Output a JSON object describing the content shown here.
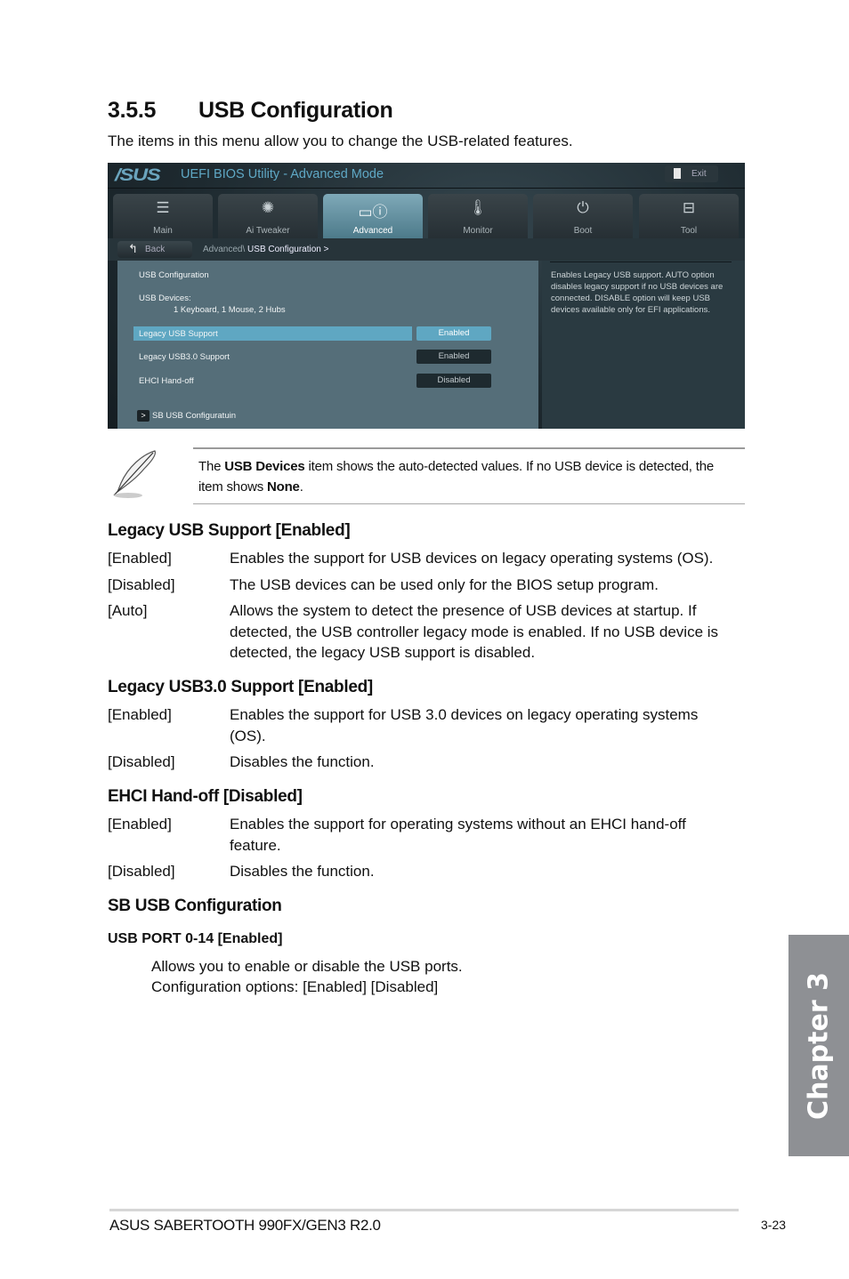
{
  "section": {
    "number": "3.5.5",
    "title": "USB Configuration",
    "intro": "The items in this menu allow you to change the USB-related features."
  },
  "bios": {
    "logo": "/SUS",
    "title": "UEFI BIOS Utility - Advanced Mode",
    "exit_label": "Exit",
    "tabs": [
      {
        "label": "Main",
        "icon": "list-icon"
      },
      {
        "label": "Ai  Tweaker",
        "icon": "fan-icon"
      },
      {
        "label": "Advanced",
        "icon": "advanced-info-icon",
        "active": true
      },
      {
        "label": "Monitor",
        "icon": "thermometer-icon"
      },
      {
        "label": "Boot",
        "icon": "power-icon"
      },
      {
        "label": "Tool",
        "icon": "toolbox-icon"
      }
    ],
    "back_label": "Back",
    "breadcrumb_parent": "Advanced\\",
    "breadcrumb_current": "USB Configuration  >",
    "panel_title": "USB Configuration",
    "devices_label": "USB Devices:",
    "devices_value": "1 Keyboard, 1 Mouse, 2 Hubs",
    "items": [
      {
        "label": "Legacy USB Support",
        "value": "Enabled"
      },
      {
        "label": "Legacy USB3.0 Support",
        "value": "Enabled"
      },
      {
        "label": "EHCI Hand-off",
        "value": "Disabled"
      }
    ],
    "submenu_arrow": ">",
    "submenu_label": "SB USB Configuratuin",
    "help_text": "Enables Legacy USB support. AUTO option disables legacy support if no USB devices are connected. DISABLE option will keep USB devices available only for EFI applications."
  },
  "note": {
    "pre": "The ",
    "bold1": "USB Devices",
    "mid": " item shows the auto-detected values. If no USB device is detected, the item shows ",
    "bold2": "None",
    "post": "."
  },
  "legacy_usb": {
    "heading": "Legacy USB Support [Enabled]",
    "options": [
      {
        "opt": "[Enabled]",
        "desc": "Enables the support for USB devices on legacy operating systems (OS)."
      },
      {
        "opt": "[Disabled]",
        "desc": "The USB devices can be used only for the BIOS setup program."
      },
      {
        "opt": "[Auto]",
        "desc": "Allows the system to detect the presence of USB devices at startup. If detected, the USB controller legacy mode is enabled. If no USB device is detected, the legacy USB support is disabled."
      }
    ]
  },
  "legacy_usb3": {
    "heading": "Legacy USB3.0 Support [Enabled]",
    "options": [
      {
        "opt": "[Enabled]",
        "desc": "Enables the support for USB 3.0 devices on legacy operating systems (OS)."
      },
      {
        "opt": "[Disabled]",
        "desc": "Disables the function."
      }
    ]
  },
  "ehci": {
    "heading": "EHCI Hand-off [Disabled]",
    "options": [
      {
        "opt": "[Enabled]",
        "desc": "Enables the support for operating systems without an EHCI hand-off feature."
      },
      {
        "opt": "[Disabled]",
        "desc": "Disables the function."
      }
    ]
  },
  "sb_usb": {
    "heading": "SB USB Configuration",
    "subheading": "USB PORT 0-14 [Enabled]",
    "line1": "Allows you to enable or disable the USB ports.",
    "line2": "Configuration options: [Enabled] [Disabled]"
  },
  "chapter_tab": "Chapter 3",
  "footer": {
    "product": "ASUS SABERTOOTH 990FX/GEN3 R2.0",
    "page": "3-23"
  }
}
